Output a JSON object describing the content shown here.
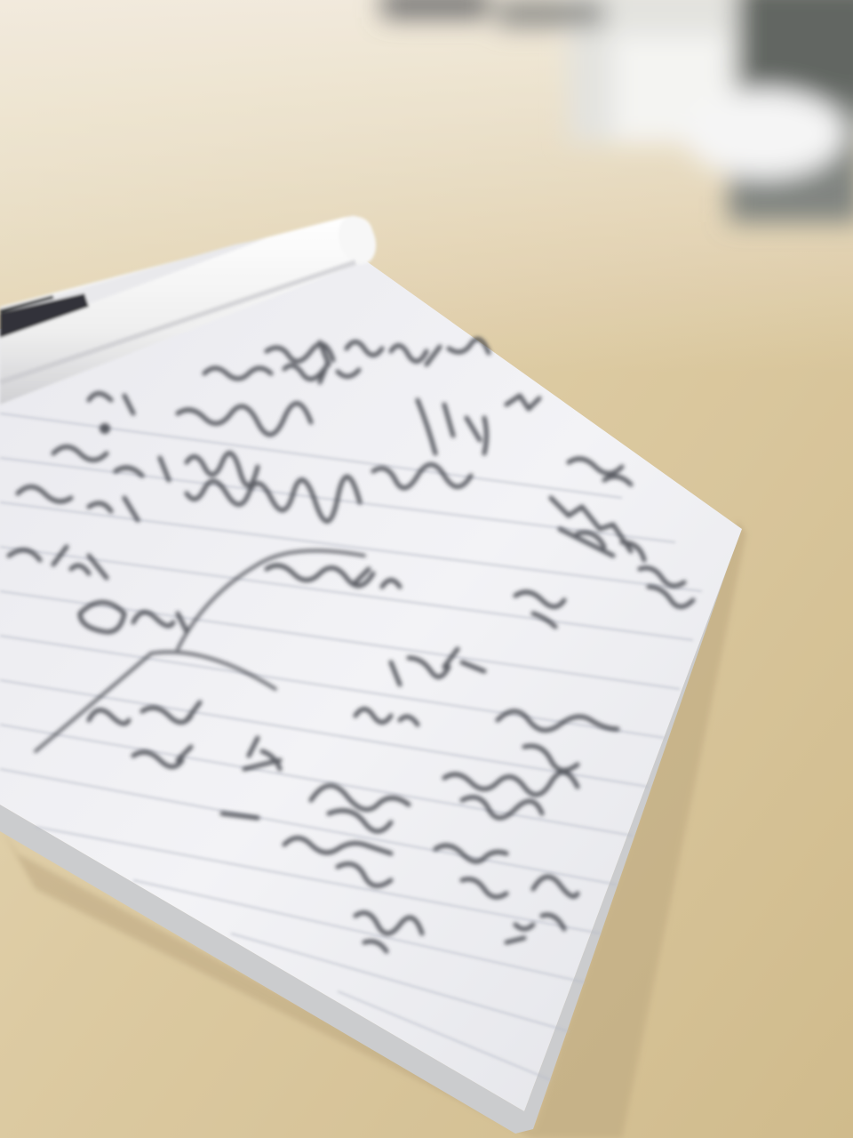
{
  "scene": {
    "subject": "handwritten-notepad-with-pen",
    "focus": "motion-blurred",
    "colors": {
      "desk": "#d8c6a0",
      "desk_light": "#e8dcc0",
      "desk_shadow": "#c9b48a",
      "background_wall": "#dcdcd8",
      "background_dark": "#5c605c",
      "paper": "#f1f1f3",
      "paper_edge": "#c9cacc",
      "ruled_line": "#b8bcc8",
      "ink": "#3a3c44",
      "pen_body": "#f4f4f4",
      "pen_clip": "#2a2c30"
    }
  }
}
